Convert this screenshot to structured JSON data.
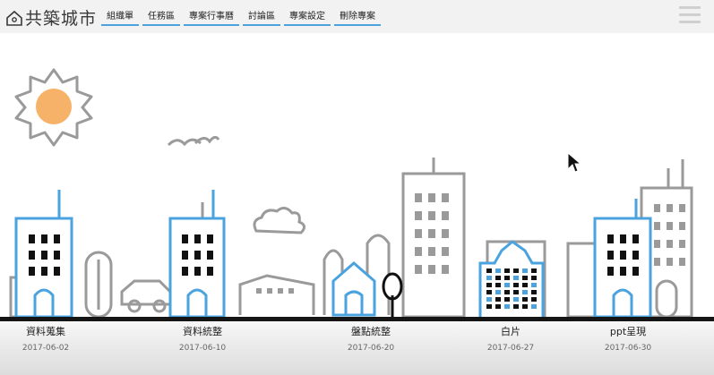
{
  "app": {
    "logo_text": "共築城市"
  },
  "nav": {
    "items": [
      {
        "label": "組織單"
      },
      {
        "label": "任務區"
      },
      {
        "label": "專案行事曆"
      },
      {
        "label": "討論區"
      },
      {
        "label": "專案設定"
      },
      {
        "label": "刪除專案"
      }
    ]
  },
  "milestones": [
    {
      "title": "資料蒐集",
      "date": "2017-06-02"
    },
    {
      "title": "資料統整",
      "date": "2017-06-10"
    },
    {
      "title": "盤點統整",
      "date": "2017-06-20"
    },
    {
      "title": "白片",
      "date": "2017-06-27"
    },
    {
      "title": "ppt呈現",
      "date": "2017-06-30"
    }
  ],
  "colors": {
    "accent": "#4aa3df",
    "outline": "#9a9a9a",
    "sun": "#f7b26a",
    "ground": "#151515"
  },
  "icons": {
    "menu": "hamburger-menu-icon",
    "logo": "house-icon",
    "cursor": "mouse-pointer-icon"
  }
}
